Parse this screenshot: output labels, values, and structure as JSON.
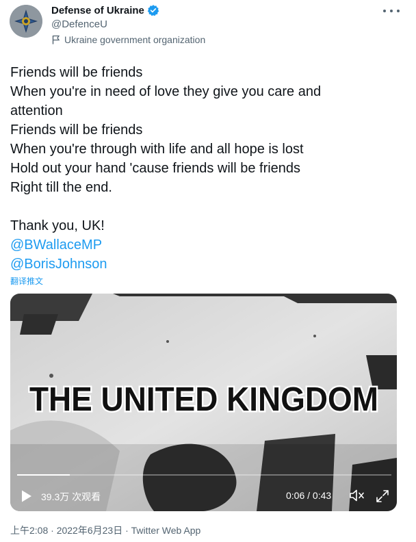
{
  "author": {
    "display_name": "Defense of Ukraine",
    "handle": "@DefenceU",
    "label": "Ukraine government organization",
    "avatar_icon": "ukraine-mod-emblem",
    "verified_color": "#1d9bf0"
  },
  "tweet": {
    "lines": [
      "Friends will be friends",
      "When you're in need of love they give you care and",
      "attention",
      "Friends will be friends",
      "When you're through with life and all hope is lost",
      "Hold out your hand 'cause friends will be friends",
      "Right till the end."
    ],
    "thanks": "Thank you, UK!",
    "mentions": [
      "@BWallaceMP",
      "@BorisJohnson"
    ],
    "translate_label": "翻译推文"
  },
  "video": {
    "overlay_title": "THE UNITED KINGDOM",
    "views": "39.3万 次观看",
    "time": "0:06 / 0:43",
    "progress": 0.14
  },
  "meta": {
    "text": "上午2:08 · 2022年6月23日 · Twitter Web App"
  },
  "colors": {
    "link": "#1d9bf0",
    "secondary_text": "#536471",
    "primary_text": "#0f1419"
  }
}
